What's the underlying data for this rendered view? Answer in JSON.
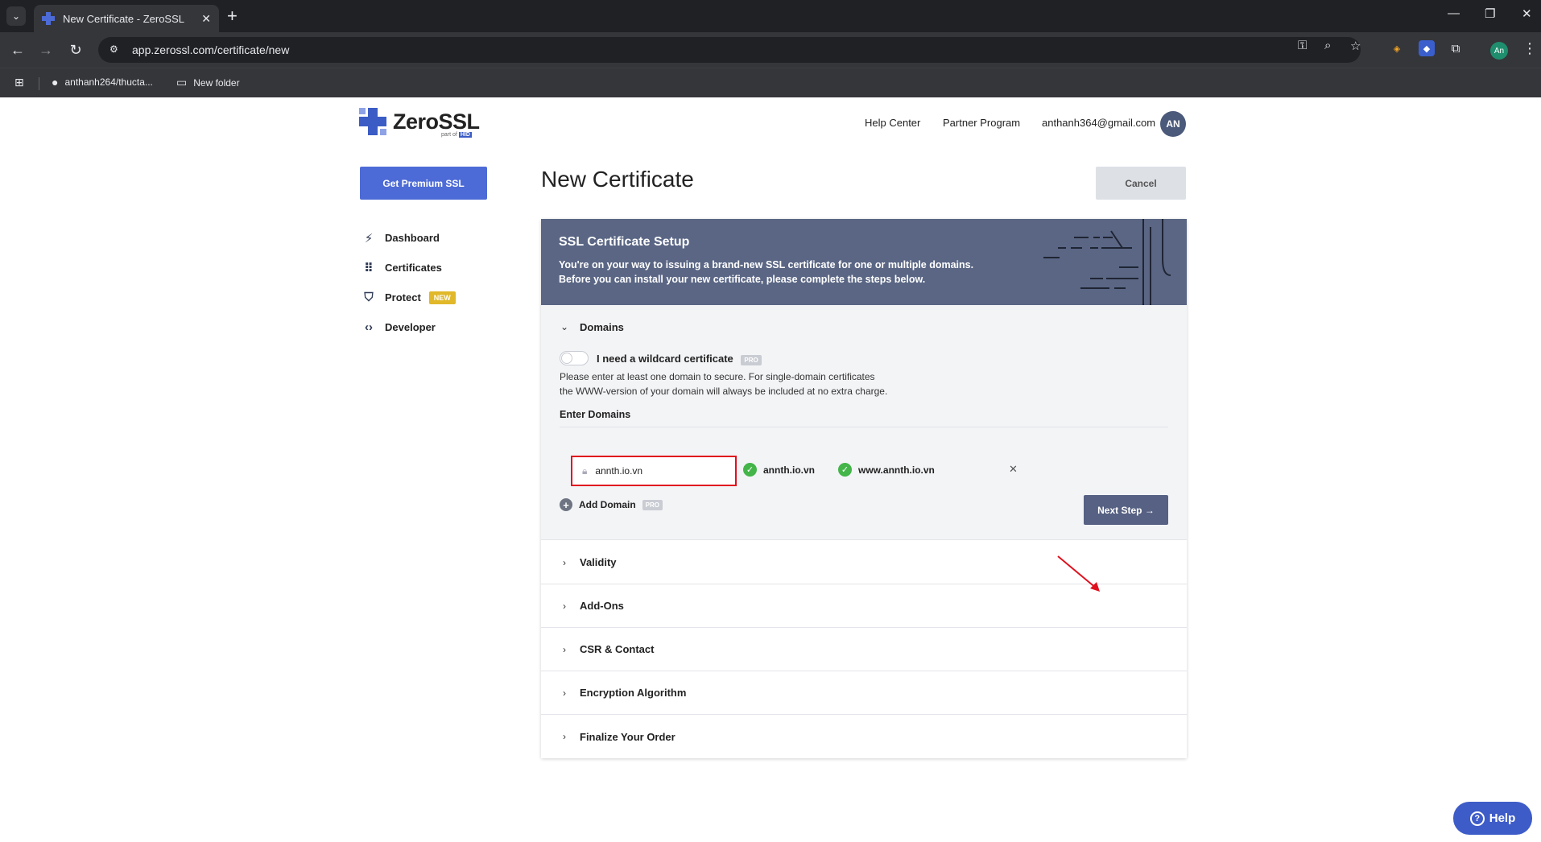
{
  "browser": {
    "tab_title": "New Certificate - ZeroSSL",
    "url": "app.zerossl.com/certificate/new",
    "bookmarks": [
      "anthanh264/thucta...",
      "New folder"
    ],
    "profile_initials": "An"
  },
  "header": {
    "logo": "ZeroSSL",
    "logo_sub": "part of",
    "logo_sub_brand": "HID",
    "nav": [
      "Help Center",
      "Partner Program"
    ],
    "user_email": "anthanh364@gmail.com",
    "avatar": "AN"
  },
  "sidebar": {
    "premium_button": "Get Premium SSL",
    "items": [
      {
        "label": "Dashboard",
        "icon": "bolt-icon"
      },
      {
        "label": "Certificates",
        "icon": "grid-icon"
      },
      {
        "label": "Protect",
        "icon": "shield-icon",
        "badge": "NEW"
      },
      {
        "label": "Developer",
        "icon": "code-icon"
      }
    ]
  },
  "main": {
    "title": "New Certificate",
    "cancel_button": "Cancel",
    "setup_title": "SSL Certificate Setup",
    "setup_desc_1": "You're on your way to issuing a brand-new SSL certificate for one or multiple domains.",
    "setup_desc_2": "Before you can install your new certificate, please complete the steps below.",
    "domains": {
      "label": "Domains",
      "wildcard_label": "I need a wildcard certificate",
      "pro_badge": "PRO",
      "help_1": "Please enter at least one domain to secure. For single-domain certificates",
      "help_2": "the WWW-version of your domain will always be included at no extra charge.",
      "enter_label": "Enter Domains",
      "input_value": "annth.io.vn",
      "chips": [
        "annth.io.vn",
        "www.annth.io.vn"
      ],
      "add_domain": "Add Domain",
      "next_button": "Next Step"
    },
    "sections": [
      "Validity",
      "Add-Ons",
      "CSR & Contact",
      "Encryption Algorithm",
      "Finalize Your Order"
    ]
  },
  "help_button": "Help",
  "colors": {
    "accent": "#4d6bd6",
    "header_bg": "#5a6684",
    "highlight": "#e0101e",
    "success": "#43b549",
    "badge_new": "#e0b829"
  }
}
